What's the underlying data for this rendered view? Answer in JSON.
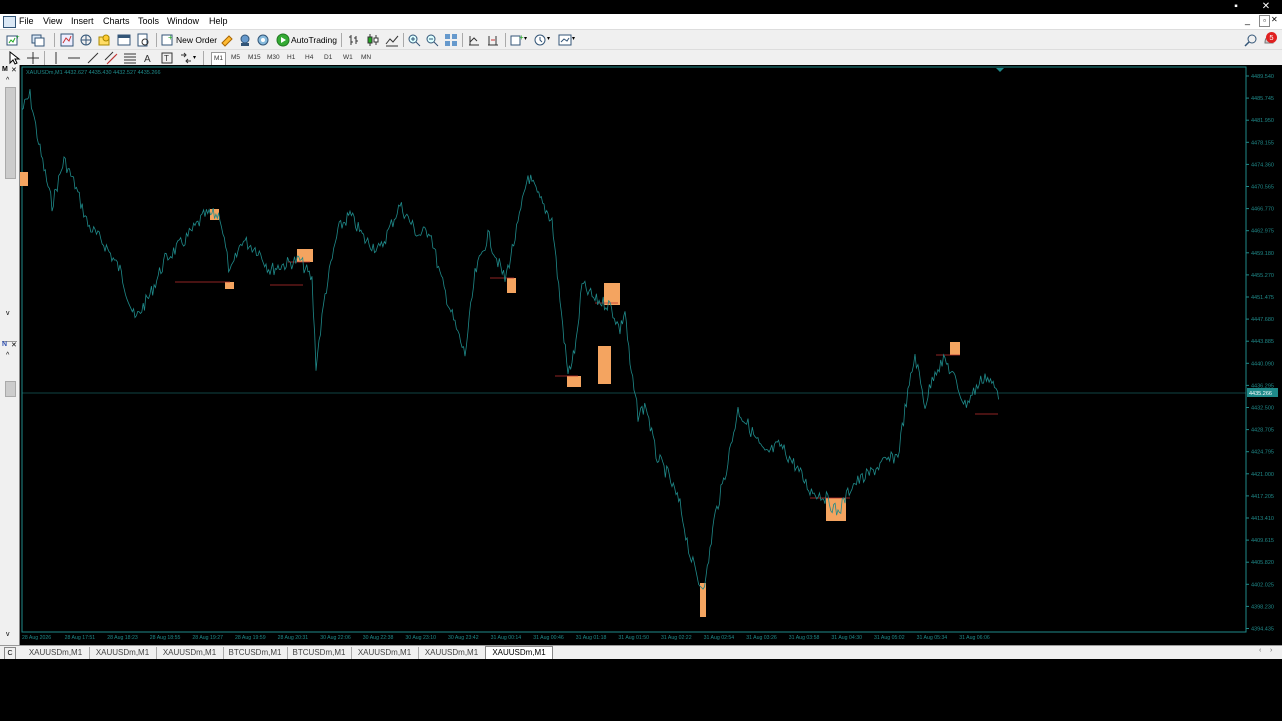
{
  "menu": {
    "items": [
      "File",
      "View",
      "Insert",
      "Charts",
      "Tools",
      "Window",
      "Help"
    ]
  },
  "toolbar": {
    "new_order_label": "New Order",
    "autotrading_label": "AutoTrading",
    "notification_count": "5",
    "timeframes": [
      "M1",
      "M5",
      "M15",
      "M30",
      "H1",
      "H4",
      "D1",
      "W1",
      "MN"
    ]
  },
  "chart": {
    "info_label": "XAUUSDm,M1  4432.627 4435.430 4432.527 4435.266",
    "current_price_label": "4435.266",
    "price_ticks": [
      "4489.540",
      "4485.745",
      "4481.950",
      "4478.155",
      "4474.360",
      "4470.565",
      "4466.770",
      "4462.975",
      "4459.180",
      "4455.270",
      "4451.475",
      "4447.680",
      "4443.885",
      "4440.090",
      "4436.295",
      "4432.500",
      "4428.705",
      "4424.795",
      "4421.000",
      "4417.205",
      "4413.410",
      "4409.615",
      "4405.820",
      "4402.025",
      "4398.230",
      "4394.435"
    ],
    "time_ticks": [
      "28 Aug 2026",
      "28 Aug 17:51",
      "28 Aug 18:23",
      "28 Aug 18:55",
      "28 Aug 19:27",
      "28 Aug 19:59",
      "28 Aug 20:31",
      "30 Aug 22:06",
      "30 Aug 22:38",
      "30 Aug 23:10",
      "30 Aug 23:42",
      "31 Aug 00:14",
      "31 Aug 00:46",
      "31 Aug 01:18",
      "31 Aug 01:50",
      "31 Aug 02:22",
      "31 Aug 02:54",
      "31 Aug 03:26",
      "31 Aug 03:58",
      "31 Aug 04:30",
      "31 Aug 05:02",
      "31 Aug 05:34",
      "31 Aug 06:06"
    ],
    "colors": {
      "background": "#000000",
      "line": "#1f8a8a",
      "axis": "#1f8a8a",
      "box": "#f4a460",
      "level": "#c03030"
    }
  },
  "tabs": [
    "XAUUSDm,M1",
    "XAUUSDm,M1",
    "XAUUSDm,M1",
    "BTCUSDm,M1",
    "BTCUSDm,M1",
    "XAUUSDm,M1",
    "XAUUSDm,M1",
    "XAUUSDm,M1"
  ],
  "active_tab_index": 7
}
